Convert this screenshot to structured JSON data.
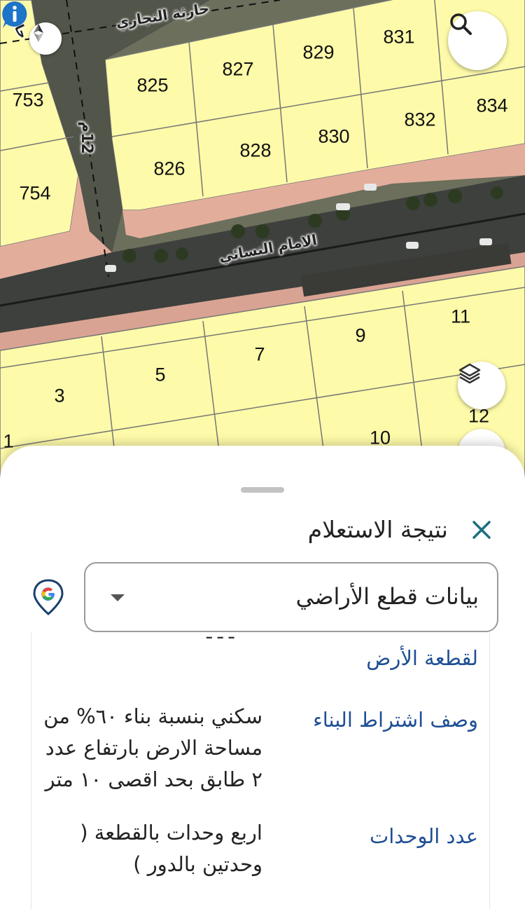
{
  "map": {
    "parcels": [
      {
        "id": "p831",
        "label": "831"
      },
      {
        "id": "p829",
        "label": "829"
      },
      {
        "id": "p827",
        "label": "827"
      },
      {
        "id": "p825",
        "label": "825"
      },
      {
        "id": "p834",
        "label": "834"
      },
      {
        "id": "p832",
        "label": "832"
      },
      {
        "id": "p830",
        "label": "830"
      },
      {
        "id": "p828",
        "label": "828"
      },
      {
        "id": "p826",
        "label": "826"
      },
      {
        "id": "p753",
        "label": "753"
      },
      {
        "id": "p754",
        "label": "754"
      },
      {
        "id": "p11",
        "label": "11"
      },
      {
        "id": "p9",
        "label": "9"
      },
      {
        "id": "p7",
        "label": "7"
      },
      {
        "id": "p5",
        "label": "5"
      },
      {
        "id": "p3",
        "label": "3"
      },
      {
        "id": "p12",
        "label": "12"
      },
      {
        "id": "p10",
        "label": "10"
      },
      {
        "id": "p1",
        "label": "1"
      }
    ],
    "streets": {
      "top": "حارثة النجاري",
      "main": "الامام النسائي",
      "side": "12م",
      "corner": "حارثة"
    },
    "icons": {
      "search": "search-icon",
      "layers": "layers-icon",
      "compass": "compass-icon",
      "info": "info-icon"
    }
  },
  "sheet": {
    "title": "نتيجة الاستعلام",
    "select": {
      "value": "بيانات قطع الأراضي",
      "options_visible": [
        "بيانات قطع الأراضي"
      ]
    },
    "rows": [
      {
        "key": "لقطعة الأرض",
        "value": ""
      },
      {
        "key": "وصف اشتراط البناء",
        "value": "سكني بنسبة بناء ٦٠% من مساحة الارض بارتفاع عدد ٢ طابق بحد اقصى ١٠ متر"
      },
      {
        "key": "عدد الوحدات",
        "value": "اربع وحدات بالقطعة ( وحدتين بالدور )"
      }
    ],
    "clipped_text_top": "ـ ـ ـ"
  },
  "colors": {
    "parcel_fill": "#fdfaa9",
    "parcel_stroke": "#777777",
    "sidewalk": "#e3ad9c",
    "road": "#3a3d3a",
    "key_text": "#1f4f94",
    "close_x": "#1b6f7e"
  }
}
